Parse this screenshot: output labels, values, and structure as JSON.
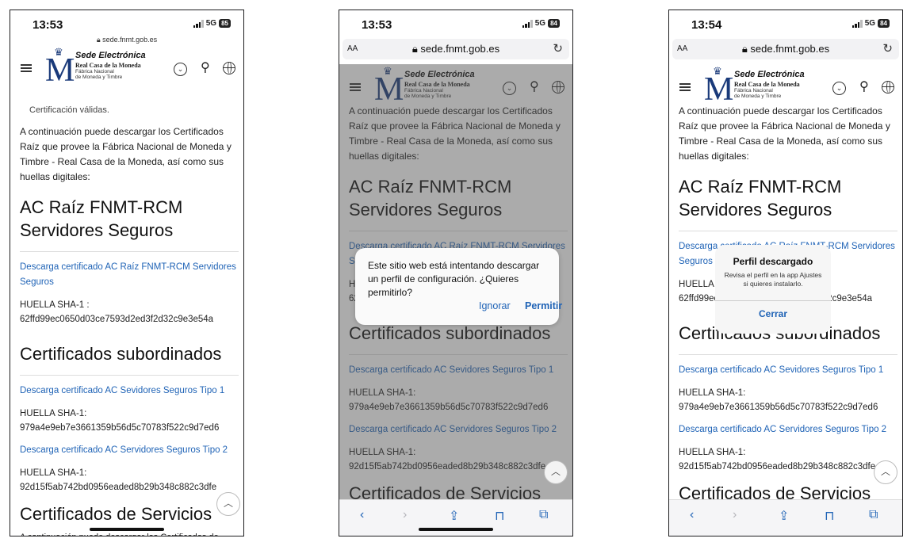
{
  "screens": [
    {
      "time": "13:53",
      "signal": "5G",
      "battery": "85",
      "url": "sede.fnmt.gob.es"
    },
    {
      "time": "13:53",
      "signal": "5G",
      "battery": "84",
      "url": "sede.fnmt.gob.es"
    },
    {
      "time": "13:54",
      "signal": "5G",
      "battery": "84",
      "url": "sede.fnmt.gob.es"
    }
  ],
  "browser": {
    "text_size": "AA"
  },
  "site": {
    "name": "Sede Electrónica",
    "line1": "Real Casa de la Moneda",
    "line2": "Fábrica Nacional",
    "line3": "de Moneda y Timbre"
  },
  "page": {
    "cut_text": "Certificación válidas.",
    "intro": "A continuación puede descargar los Certificados Raíz que provee la Fábrica Nacional de Moneda y Timbre - Real Casa de la Moneda, así como sus huellas digitales:",
    "heading_root": "AC Raíz FNMT-RCM Servidores Seguros",
    "link_root": "Descarga certificado AC Raíz FNMT-RCM Servidores Seguros",
    "hash_label_root": "HUELLA SHA-1 :",
    "hash_root": "62ffd99ec0650d03ce7593d2ed3f2d32c9e3e54a",
    "heading_sub": "Certificados subordinados",
    "link_sub1": "Descarga certificado AC Sevidores Seguros Tipo 1",
    "hash_label": "HUELLA SHA-1:",
    "hash_sub1": "979a4e9eb7e3661359b56d5c70783f522c9d7ed6",
    "link_sub2": "Descarga certificado AC Servidores Seguros Tipo 2",
    "hash_sub2": "92d15f5ab742bd0956eaded8b29b348c882c3dfe",
    "heading_serv": "Certificados de Servicios",
    "serv_text": "A continuación puede descargar los Certificados de servicios para las CAs que provee la Fábrica Nacional"
  },
  "alert_download": {
    "message": "Este sitio web está intentando descargar un perfil de configuración. ¿Quieres permitirlo?",
    "ignore": "Ignorar",
    "allow": "Permitir"
  },
  "alert_profile": {
    "title": "Perfil descargado",
    "message": "Revisa el perfil en la app Ajustes si quieres instalarlo.",
    "close": "Cerrar"
  },
  "icons": [
    "menu-icon",
    "chevron-down-icon",
    "search-icon",
    "globe-icon",
    "lock-icon",
    "reload-icon",
    "back-icon",
    "forward-icon",
    "share-icon",
    "bookmarks-icon",
    "tabs-icon",
    "scroll-top-icon"
  ]
}
